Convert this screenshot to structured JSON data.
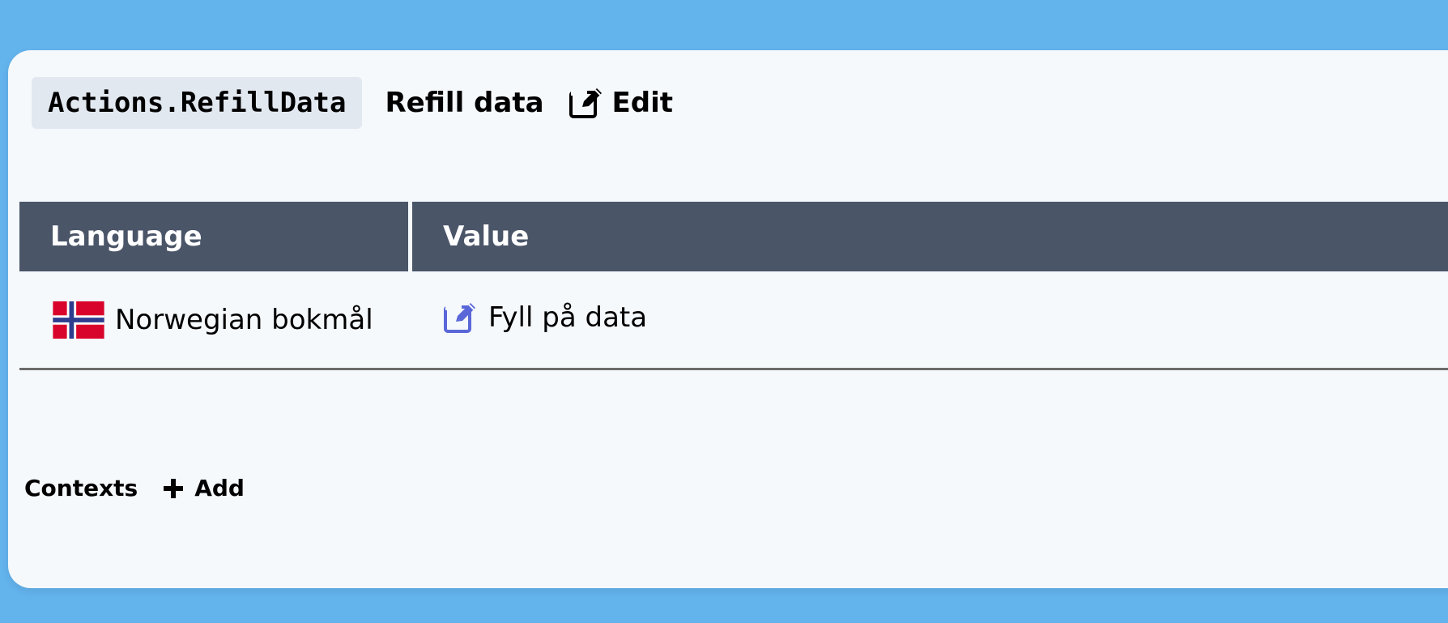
{
  "key": {
    "code": "Actions.RefillData",
    "title": "Refill data",
    "edit_label": "Edit"
  },
  "table": {
    "headers": {
      "language": "Language",
      "value": "Value"
    },
    "rows": [
      {
        "language": "Norwegian bokmål",
        "flag": "norway-flag-icon",
        "value": "Fyll på data"
      }
    ]
  },
  "contexts": {
    "label": "Contexts",
    "add_label": "Add"
  },
  "colors": {
    "background": "#63b3ed",
    "card": "#f5f9fc",
    "header": "#4a5568",
    "edit_accent": "#5a67d8"
  }
}
